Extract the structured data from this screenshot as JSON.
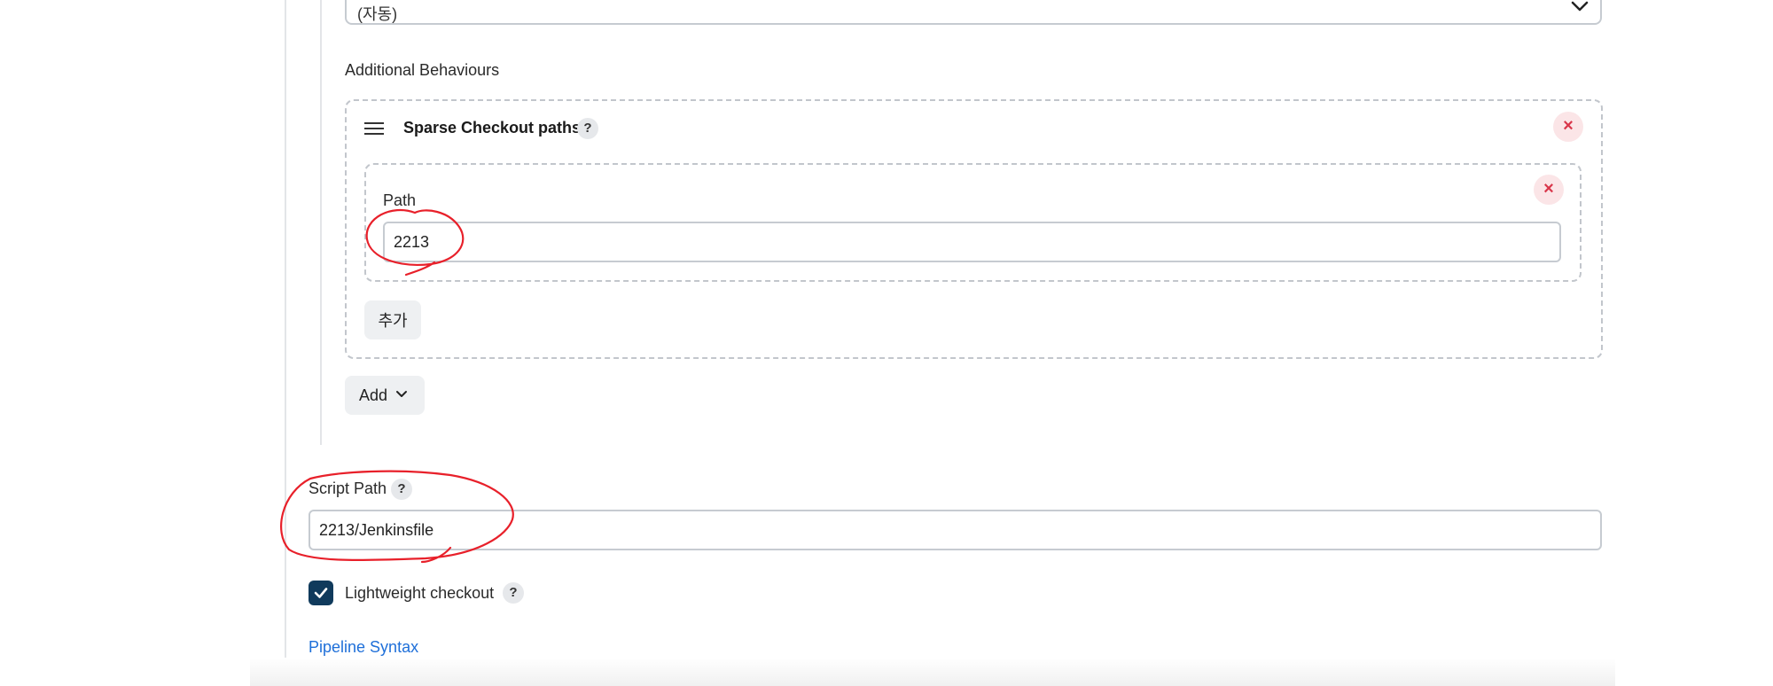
{
  "form": {
    "select_value": "(자동)",
    "additional_behaviours_label": "Additional Behaviours",
    "sparse_checkout": {
      "title": "Sparse Checkout paths",
      "path_label": "Path",
      "path_value": "2213",
      "add_path_label": "추가"
    },
    "add_button_label": "Add",
    "script_path_label": "Script Path",
    "script_path_value": "2213/Jenkinsfile",
    "lightweight_checkout_label": "Lightweight checkout",
    "lightweight_checkout_checked": true,
    "pipeline_syntax_link": "Pipeline Syntax",
    "help_glyph": "?",
    "close_glyph": "×"
  },
  "icons": {
    "select_chevron": "chevron-down-icon",
    "drag_handle": "drag-handle-icon",
    "add_chevron": "chevron-down-icon",
    "checkbox_check": "check-icon",
    "help": "help-icon",
    "close": "close-icon"
  },
  "colors": {
    "annotation_red": "#e8202a",
    "link_blue": "#1e6fd9",
    "checkbox_fill": "#103a5c",
    "close_red": "#d9364a"
  }
}
